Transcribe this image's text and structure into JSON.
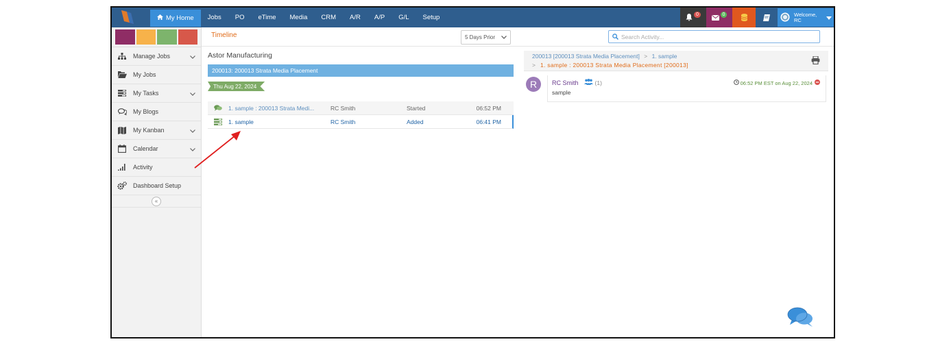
{
  "nav": {
    "home": "My Home",
    "items": [
      "Jobs",
      "PO",
      "eTime",
      "Media",
      "CRM",
      "A/R",
      "A/P",
      "G/L",
      "Setup"
    ],
    "notifications_count": "0",
    "messages_count": "0",
    "welcome_line1": "Welcome,",
    "welcome_line2": "RC"
  },
  "sidebar": {
    "swatch_colors": [
      "#8f2d65",
      "#f7b24a",
      "#7db46c",
      "#d7584a"
    ],
    "items": [
      {
        "label": "Manage Jobs",
        "icon": "sitemap-icon",
        "expandable": true
      },
      {
        "label": "My Jobs",
        "icon": "folder-open-icon",
        "expandable": false
      },
      {
        "label": "My Tasks",
        "icon": "tasks-icon",
        "expandable": true
      },
      {
        "label": "My Blogs",
        "icon": "comments-icon",
        "expandable": false
      },
      {
        "label": "My Kanban",
        "icon": "map-icon",
        "expandable": true
      },
      {
        "label": "Calendar",
        "icon": "calendar-icon",
        "expandable": true
      },
      {
        "label": "Activity",
        "icon": "signal-icon",
        "expandable": false
      },
      {
        "label": "Dashboard Setup",
        "icon": "cogs-icon",
        "expandable": false
      }
    ]
  },
  "timeline": {
    "title": "Timeline",
    "range_select": "5 Days Prior",
    "search_placeholder": "Search Activity..."
  },
  "left": {
    "company": "Astor Manufacturing",
    "job_bar": "200013: 200013 Strata Media Placement",
    "date_tag": "Thu Aug 22, 2024",
    "rows": [
      {
        "icon": "comment-icon",
        "desc": "1. sample : 200013 Strata Medi...",
        "user": "RC Smith",
        "status": "Started",
        "time": "06:52 PM"
      },
      {
        "icon": "tasks-icon",
        "desc": "1. sample",
        "user": "RC Smith",
        "status": "Added",
        "time": "06:41 PM"
      }
    ]
  },
  "right": {
    "crumb_job": "200013 [200013 Strata Media Placement]",
    "crumb_sep": ">",
    "crumb_task": "1. sample",
    "crumb_line2": "1. sample : 200013 Strata Media Placement [200013]",
    "post": {
      "avatar_letter": "R",
      "user": "RC Smith",
      "group_count": "(1)",
      "text": "sample",
      "timestamp": "06:52 PM EST on Aug 22, 2024"
    }
  },
  "colors": {
    "topbar": "#2f5e8e",
    "accent": "#3a8fd9",
    "timeline_title": "#e06b18",
    "annotation_arrow": "#e02020"
  }
}
